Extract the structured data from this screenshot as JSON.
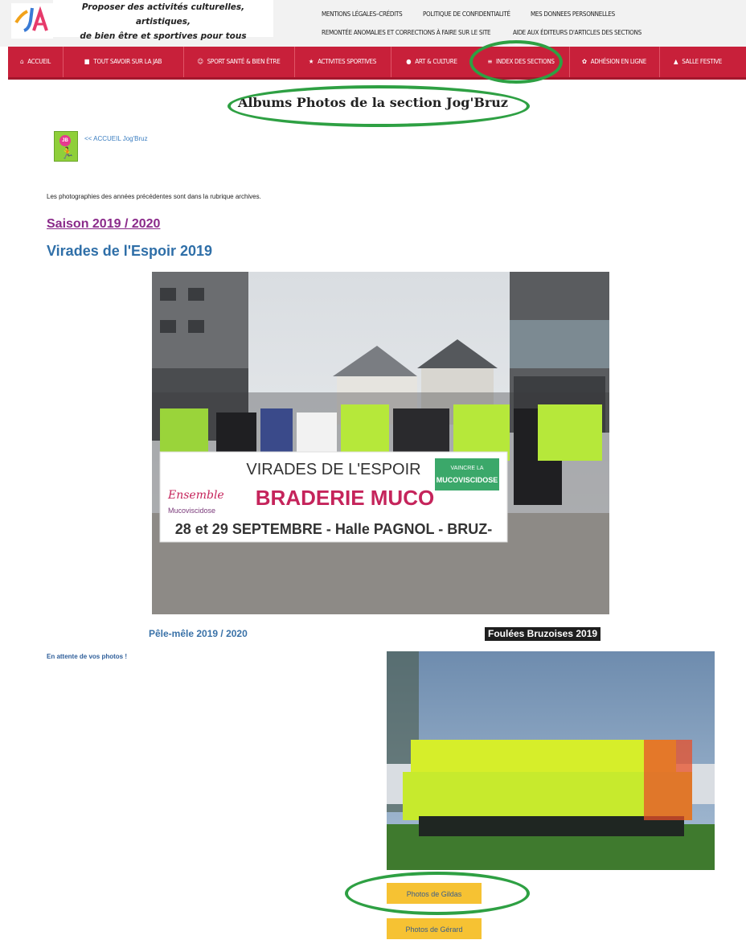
{
  "header": {
    "tagline_line1": "Proposer des activités culturelles, artistiques,",
    "tagline_line2": "de bien être et sportives pour tous",
    "links": {
      "mentions": "MENTIONS LÉGALES–CRÉDITS",
      "politique": "POLITIQUE DE CONFIDENTIALITÉ",
      "donnees": "MES DONNEES PERSONNELLES",
      "remontee": "REMONTÉE ANOMALIES ET CORRECTIONS À FAIRE SUR LE SITE",
      "aide": "AIDE AUX ÉDITEURS D'ARTICLES DES SECTIONS"
    }
  },
  "nav": {
    "accueil": "ACCUEIL",
    "savoir": "TOUT SAVOIR SUR LA JAB",
    "sport_sante": "SPORT SANTÉ & BIEN ÊTRE",
    "activites": "ACTIVITES SPORTIVES",
    "art": "ART & CULTURE",
    "index": "INDEX DES SECTIONS",
    "adhesion": "ADHÉSION EN LIGNE",
    "salle": "SALLE FESTIVE"
  },
  "main": {
    "title": "Albums Photos de la section Jog'Bruz",
    "back_link": "<< ACCUEIL Jog'Bruz",
    "info": "Les photographies des années précédentes sont dans la rubrique archives.",
    "season": "Saison 2019 / 2020",
    "virades_heading": "Virades de l'Espoir 2019",
    "banner": {
      "line1": "VIRADES DE L'ESPOIR",
      "line2": "BRADERIE MUCO",
      "line3": "28 et 29 SEPTEMBRE - Halle PAGNOL - BRUZ-",
      "logo_left": "Ensemble",
      "logo_left_sub": "Mucoviscidose",
      "logo_right": "MUCOVISCIDOSE",
      "logo_right_top": "VAINCRE LA"
    },
    "pele_heading": "Pêle-mêle 2019 / 2020",
    "foulees_heading": "Foulées Bruzoises 2019",
    "waiting": "En attente de vos photos !",
    "btn_gildas": "Photos de Gildas",
    "btn_gerard": "Photos de Gérard"
  },
  "colors": {
    "nav_red": "#c8203a",
    "highlight_green": "#2ea043",
    "button_yellow": "#f6c233",
    "heading_blue": "#2f6fa8",
    "season_purple": "#8a2a8a"
  }
}
